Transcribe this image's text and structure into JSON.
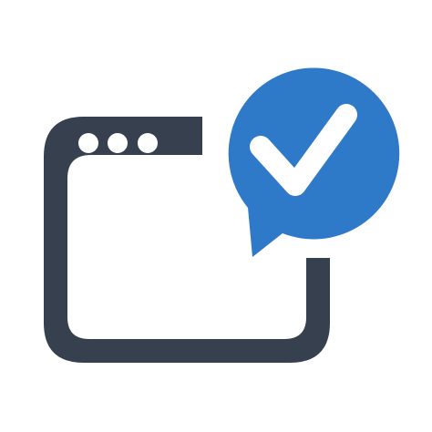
{
  "icon": {
    "name": "browser-window-verified-icon",
    "colors": {
      "window_frame": "#36404e",
      "window_dots": "#ffffff",
      "bubble": "#2f7ac8",
      "checkmark": "#ffffff",
      "background": "#ffffff"
    },
    "title_bar_dots": 3
  }
}
